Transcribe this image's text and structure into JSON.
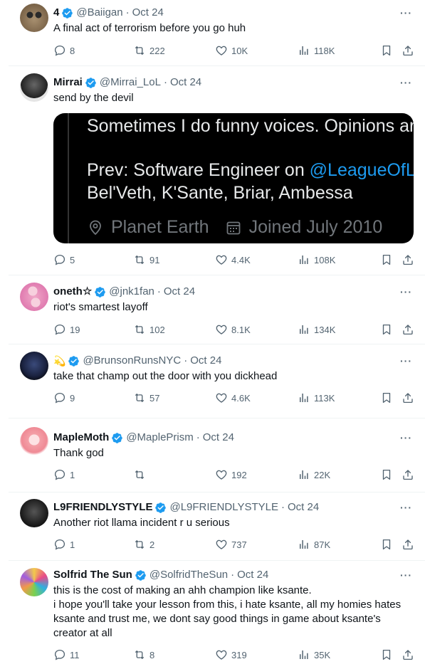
{
  "colors": {
    "verified": "#1d9bf0",
    "text": "#0f1419",
    "secondary": "#536471",
    "divider": "#eff3f4",
    "mention": "#1d9bf0"
  },
  "tweets": [
    {
      "name": "4",
      "handle": "@Baiigan",
      "date": "Oct 24",
      "text": "A final act of terrorism before you go huh",
      "replies": "8",
      "retweets": "222",
      "likes": "10K",
      "views": "118K",
      "verified": true
    },
    {
      "name": "Mirrai",
      "handle": "@Mirrai_LoL",
      "date": "Oct 24",
      "text": "send by the devil",
      "replies": "5",
      "retweets": "91",
      "likes": "4.4K",
      "views": "108K",
      "verified": true,
      "embed": {
        "line1": "Sometimes I do funny voices. Opinions are",
        "line2_prefix": "Prev: Software Engineer on ",
        "line2_mention": "@LeagueOfLeg",
        "line3": "Bel'Veth, K'Sante, Briar, Ambessa",
        "location": "Planet Earth",
        "joined": "Joined July 2010"
      }
    },
    {
      "name": "oneth☆",
      "handle": "@jnk1fan",
      "date": "Oct 24",
      "text": "riot's smartest layoff",
      "replies": "19",
      "retweets": "102",
      "likes": "8.1K",
      "views": "134K",
      "verified": true
    },
    {
      "name": "",
      "handle": "@BrunsonRunsNYC",
      "date": "Oct 24",
      "text": "take that champ out the door with you dickhead",
      "replies": "9",
      "retweets": "57",
      "likes": "4.6K",
      "views": "113K",
      "verified": true,
      "name_icon": "shooting-star-emoji"
    },
    {
      "name": "MapleMoth",
      "handle": "@MaplePrism",
      "date": "Oct 24",
      "text": "Thank god",
      "replies": "1",
      "retweets": "",
      "likes": "192",
      "views": "22K",
      "verified": true
    },
    {
      "name": "L9FRIENDLYSTYLE",
      "handle": "@L9FRIENDLYSTYLE",
      "date": "Oct 24",
      "text": "Another riot llama incident r u serious",
      "replies": "1",
      "retweets": "2",
      "likes": "737",
      "views": "87K",
      "verified": true
    },
    {
      "name": "Solfrid The Sun",
      "handle": "@SolfridTheSun",
      "date": "Oct 24",
      "text_lines": [
        "this is the cost of making an ahh champion like ksante.",
        "i hope you'll take your lesson from this, i hate ksante, all my homies hates",
        "ksante and trust me, we dont say good things in game about ksante's",
        "creator at all"
      ],
      "replies": "11",
      "retweets": "8",
      "likes": "319",
      "views": "35K",
      "verified": true
    }
  ],
  "ui": {
    "separator": "·",
    "more": "···"
  }
}
